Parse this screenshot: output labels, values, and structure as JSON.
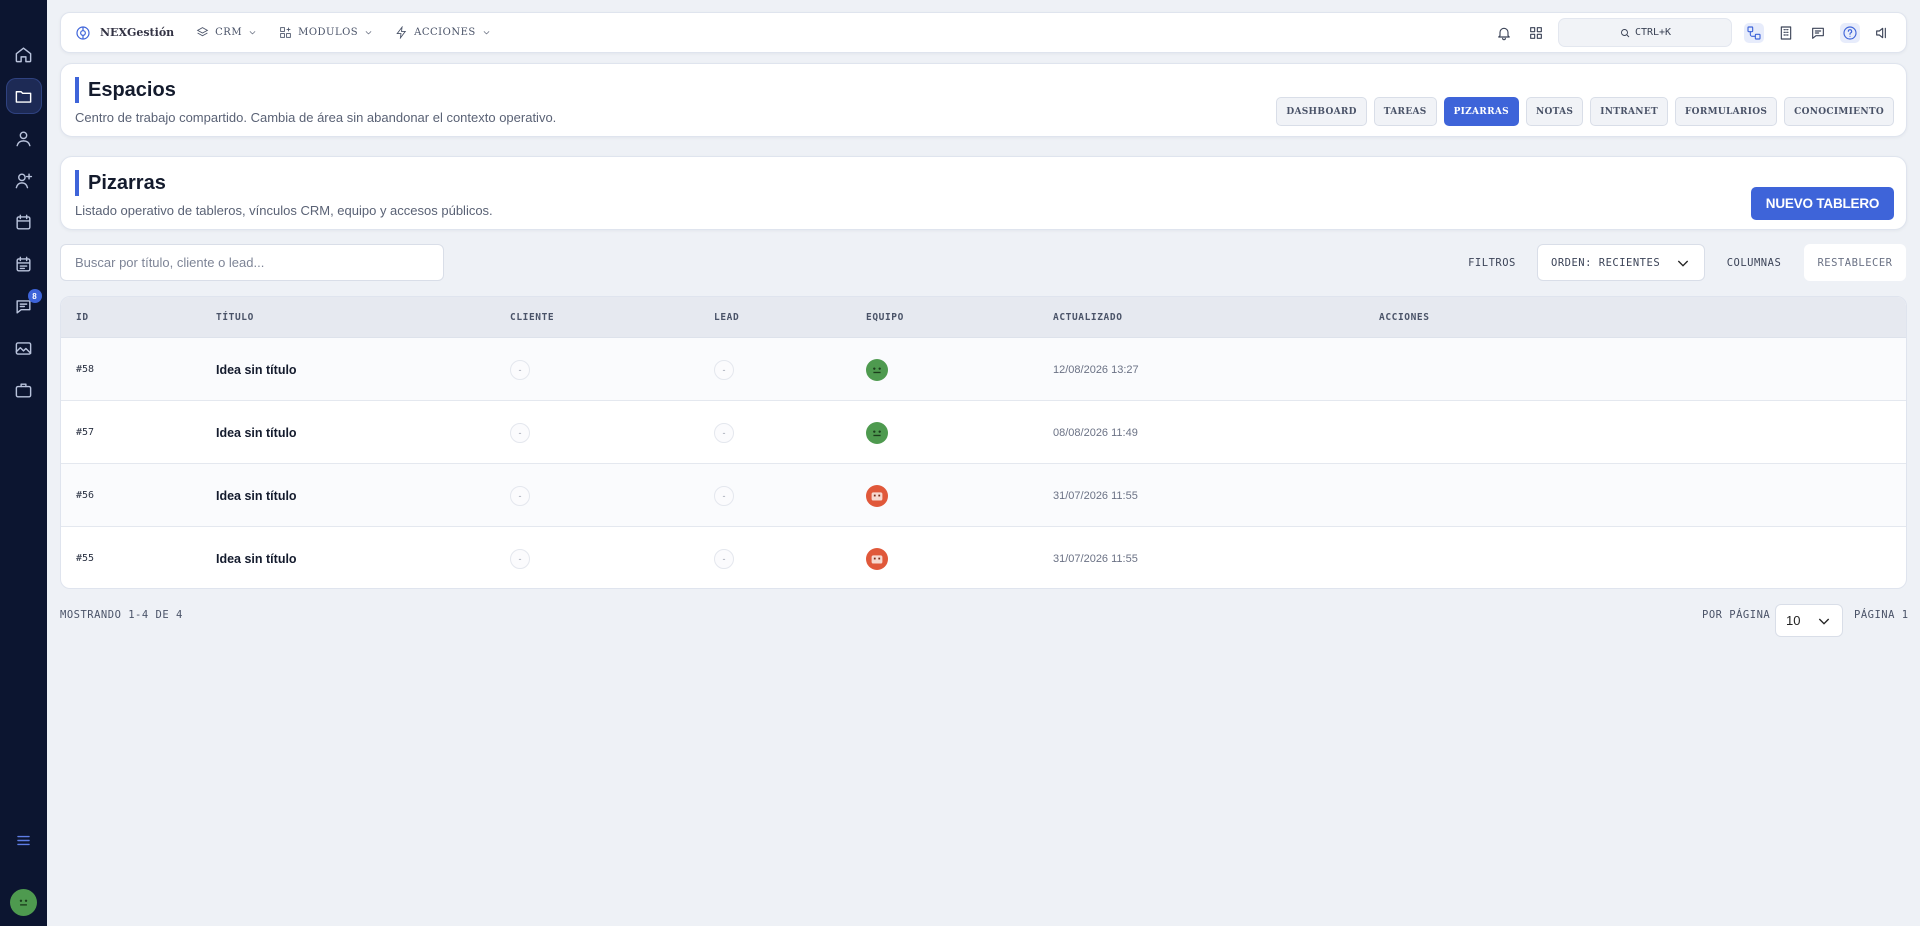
{
  "app": {
    "brand": "NEXGestión"
  },
  "nav": [
    {
      "label": "CRM",
      "icon": "layers-icon"
    },
    {
      "label": "MODULOS",
      "icon": "modules-icon"
    },
    {
      "label": "ACCIONES",
      "icon": "bolt-icon"
    }
  ],
  "search": {
    "shortcut": "CTRL+K"
  },
  "sidebar": {
    "items": [
      {
        "icon": "home-icon"
      },
      {
        "icon": "folder-icon",
        "active": true
      },
      {
        "icon": "user-icon"
      },
      {
        "icon": "user-plus-icon"
      },
      {
        "icon": "calendar-icon"
      },
      {
        "icon": "calendar-check-icon"
      },
      {
        "icon": "chat-icon",
        "badge": "8"
      },
      {
        "icon": "image-icon"
      },
      {
        "icon": "briefcase-icon"
      }
    ]
  },
  "spaces": {
    "title": "Espacios",
    "subtitle": "Centro de trabajo compartido. Cambia de área sin abandonar el contexto operativo.",
    "tabs": [
      "DASHBOARD",
      "TAREAS",
      "PIZARRAS",
      "NOTAS",
      "INTRANET",
      "FORMULARIOS",
      "CONOCIMIENTO"
    ],
    "active_tab": "PIZARRAS"
  },
  "boards": {
    "title": "Pizarras",
    "subtitle": "Listado operativo de tableros, vínculos CRM, equipo y accesos públicos.",
    "new_button": "NUEVO TABLERO"
  },
  "toolbar": {
    "search_placeholder": "Buscar por título, cliente o lead...",
    "filters": "FILTROS",
    "order": "ORDEN: RECIENTES",
    "columns": "COLUMNAS",
    "reset": "RESTABLECER"
  },
  "table": {
    "columns": [
      "ID",
      "TÍTULO",
      "CLIENTE",
      "LEAD",
      "EQUIPO",
      "ACTUALIZADO",
      "ACCIONES"
    ],
    "rows": [
      {
        "id": "#58",
        "title": "Idea sin título",
        "client": "-",
        "lead": "-",
        "team_color": "#4e9a4f",
        "updated": "12/08/2026 13:27"
      },
      {
        "id": "#57",
        "title": "Idea sin título",
        "client": "-",
        "lead": "-",
        "team_color": "#4e9a4f",
        "updated": "08/08/2026 11:49"
      },
      {
        "id": "#56",
        "title": "Idea sin título",
        "client": "-",
        "lead": "-",
        "team_color": "#e0583a",
        "updated": "31/07/2026 11:55"
      },
      {
        "id": "#55",
        "title": "Idea sin título",
        "client": "-",
        "lead": "-",
        "team_color": "#e0583a",
        "updated": "31/07/2026 11:55"
      }
    ]
  },
  "footer": {
    "showing": "MOSTRANDO 1-4 DE 4",
    "per_page_label": "POR PÁGINA",
    "per_page": "10",
    "page": "PÁGINA 1"
  }
}
